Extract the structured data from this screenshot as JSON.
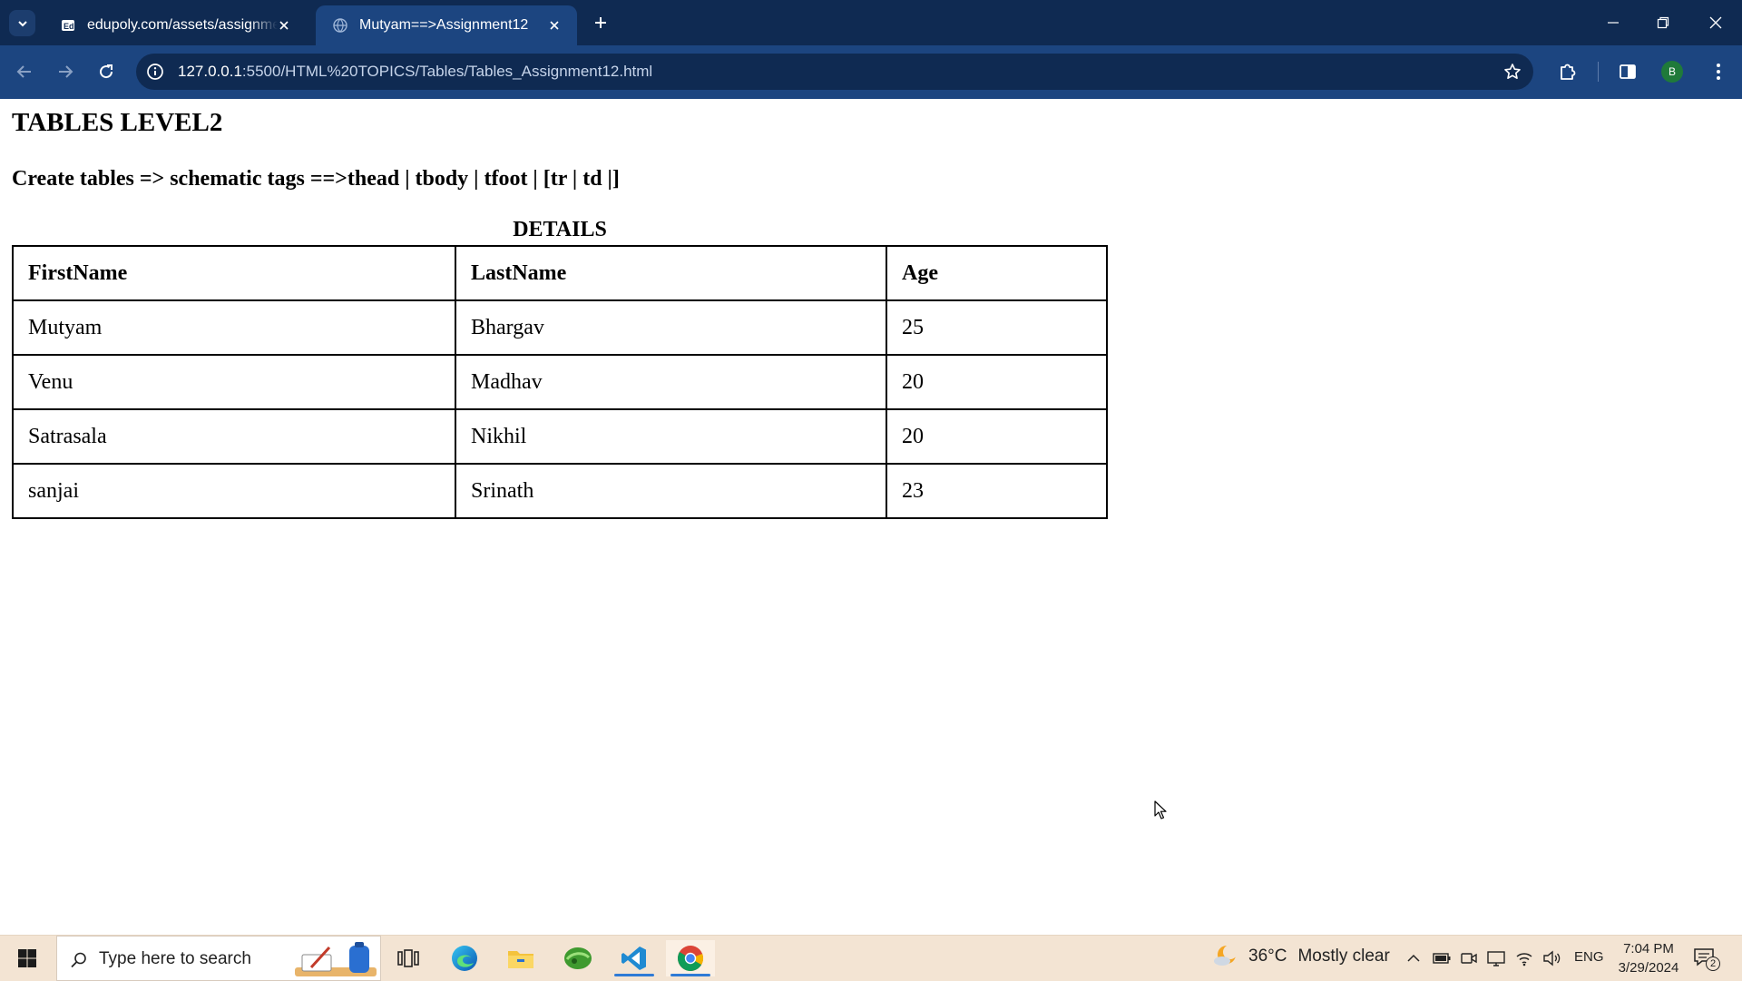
{
  "browser": {
    "tabs": [
      {
        "label": "edupoly.com/assets/assignmen",
        "active": false
      },
      {
        "label": "Mutyam==>Assignment12",
        "active": true
      }
    ],
    "url_host": "127.0.0.1",
    "url_rest": ":5500/HTML%20TOPICS/Tables/Tables_Assignment12.html",
    "profile_initial": "B",
    "accent_color": "#1c4580"
  },
  "page": {
    "heading": "TABLES LEVEL2",
    "subheading": "Create tables => schematic tags ==>thead | tbody | tfoot | [tr | td |]",
    "table": {
      "caption": "DETAILS",
      "headers": [
        "FirstName",
        "LastName",
        "Age"
      ],
      "rows": [
        [
          "Mutyam",
          "Bhargav",
          "25"
        ],
        [
          "Venu",
          "Madhav",
          "20"
        ],
        [
          "Satrasala",
          "Nikhil",
          "20"
        ],
        [
          "sanjai",
          "Srinath",
          "23"
        ]
      ]
    }
  },
  "taskbar": {
    "search_placeholder": "Type here to search",
    "weather_temp": "36°C",
    "weather_text": "Mostly clear",
    "language": "ENG",
    "time": "7:04 PM",
    "date": "3/29/2024",
    "notification_count": "2"
  }
}
